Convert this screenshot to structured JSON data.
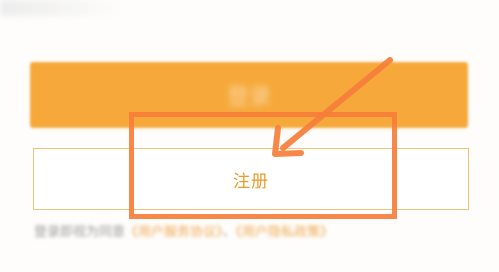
{
  "colors": {
    "accent": "#f6a93a",
    "register_text": "#e89a2a",
    "register_border": "#f0c37a",
    "annotation": "#f77e3a"
  },
  "login_button": {
    "label": "登录"
  },
  "register_button": {
    "label": "注册"
  },
  "agreement": {
    "prefix": "登录即视为同意",
    "service_link": "《用户服务协议》",
    "privacy_link": "《用户隐私政策》"
  },
  "annotation": {
    "icon": "arrow-icon"
  }
}
